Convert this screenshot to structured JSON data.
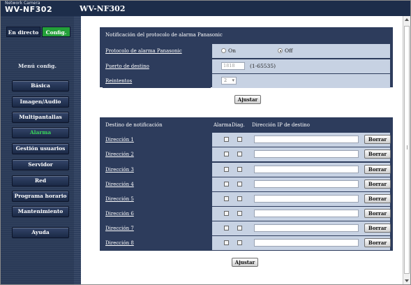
{
  "header": {
    "brand_line1": "Network Camera",
    "brand_line2": "WV-NF302",
    "title": "WV-NF302"
  },
  "sidebar": {
    "live_label": "En directo",
    "setup_label": "Config.",
    "menu_title": "Menú config.",
    "items": [
      {
        "label": "Básica",
        "active": false
      },
      {
        "label": "Imagen/Audio",
        "active": false
      },
      {
        "label": "Multipantallas",
        "active": false
      },
      {
        "label": "Alarma",
        "active": true
      },
      {
        "label": "Gestión usuarios",
        "active": false
      },
      {
        "label": "Servidor",
        "active": false
      },
      {
        "label": "Red",
        "active": false
      },
      {
        "label": "Programa horario",
        "active": false
      },
      {
        "label": "Mantenimiento",
        "active": false
      },
      {
        "label": "Ayuda",
        "active": false
      }
    ]
  },
  "protocol": {
    "section_title": "Notificación del protocolo de alarma Panasonic",
    "enable_label": "Protocolo de alarma Panasonic",
    "on_label": "On",
    "off_label": "Off",
    "selected": "Off",
    "port_label": "Puerto de destino",
    "port_value": "1818",
    "port_range": "(1-65535)",
    "retry_label": "Reintentos",
    "retry_value": "2",
    "set_button": "Ajustar"
  },
  "destinations": {
    "col_destination": "Destino de notificación",
    "col_alarm": "Alarma",
    "col_diag": "Diag.",
    "col_ip": "Dirección IP de destino",
    "delete_label": "Borrar",
    "rows": [
      {
        "label": "Dirección 1"
      },
      {
        "label": "Dirección 2"
      },
      {
        "label": "Dirección 3"
      },
      {
        "label": "Dirección 4"
      },
      {
        "label": "Dirección 5"
      },
      {
        "label": "Dirección 6"
      },
      {
        "label": "Dirección 7"
      },
      {
        "label": "Dirección 8"
      }
    ],
    "set_button": "Ajustar"
  },
  "colors": {
    "header_bg": "#1d2d4a",
    "sidebar_bg": "#2a3a57",
    "setup_green": "#23a039",
    "active_menu_text": "#39d65a",
    "panel_bg": "#2d3c5c",
    "value_cell_bg": "#c7d2e3"
  }
}
